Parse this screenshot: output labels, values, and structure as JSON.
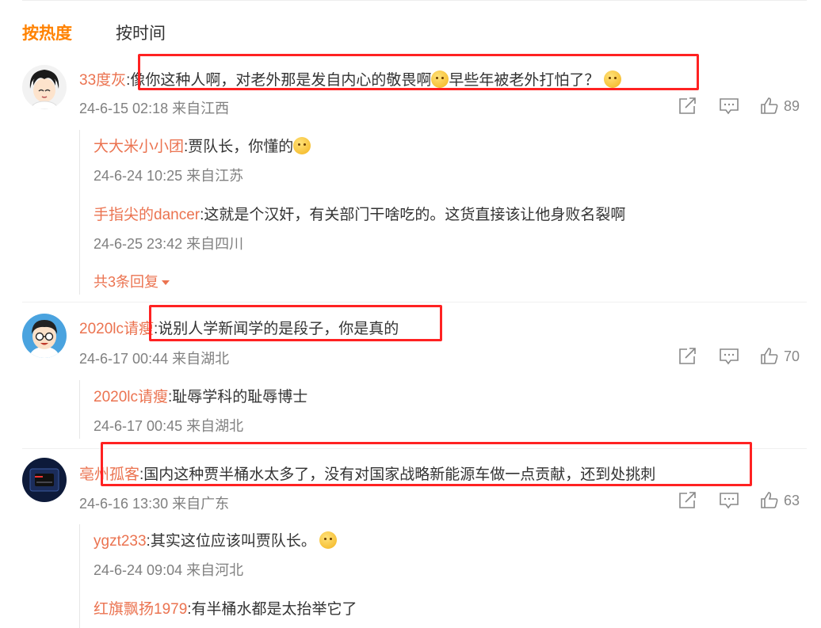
{
  "sort": {
    "hot": "按热度",
    "time": "按时间"
  },
  "comments": [
    {
      "user": "33度灰",
      "text": ":像你这种人啊，对老外那是发自内心的敬畏啊",
      "text_b": "早些年被老外打怕了？",
      "meta": "24-6-15 02:18 来自江西",
      "likes": "89",
      "replies": [
        {
          "user": "大大米小小团",
          "text": ":贾队长，你懂的",
          "meta": "24-6-24 10:25 来自江苏"
        },
        {
          "user": "手指尖的dancer",
          "text": ":这就是个汉奸，有关部门干啥吃的。这货直接该让他身败名裂啊",
          "meta": "24-6-25 23:42 来自四川"
        }
      ],
      "more": "共3条回复"
    },
    {
      "user": "2020lc请瘦",
      "text": ":说别人学新闻学的是段子，你是真的",
      "meta": "24-6-17 00:44 来自湖北",
      "likes": "70",
      "replies": [
        {
          "user": "2020lc请瘦",
          "text": ":耻辱学科的耻辱博士",
          "meta": "24-6-17 00:45 来自湖北"
        }
      ]
    },
    {
      "user": "亳州孤客",
      "text": ":国内这种贾半桶水太多了，没有对国家战略新能源车做一点贡献，还到处挑刺",
      "meta": "24-6-16 13:30 来自广东",
      "likes": "63",
      "replies": [
        {
          "user": "ygzt233",
          "text": ":其实这位应该叫贾队长。",
          "meta": "24-6-24 09:04 来自河北"
        },
        {
          "user": "红旗飘扬1979",
          "text": ":有半桶水都是太抬举它了"
        }
      ]
    }
  ],
  "colors": {
    "accent": "#ff8200",
    "username": "#eb7350",
    "highlight": "#ff2222",
    "meta": "#808080"
  },
  "icons": [
    "share-icon",
    "comment-icon",
    "like-icon",
    "caret-down-icon"
  ]
}
